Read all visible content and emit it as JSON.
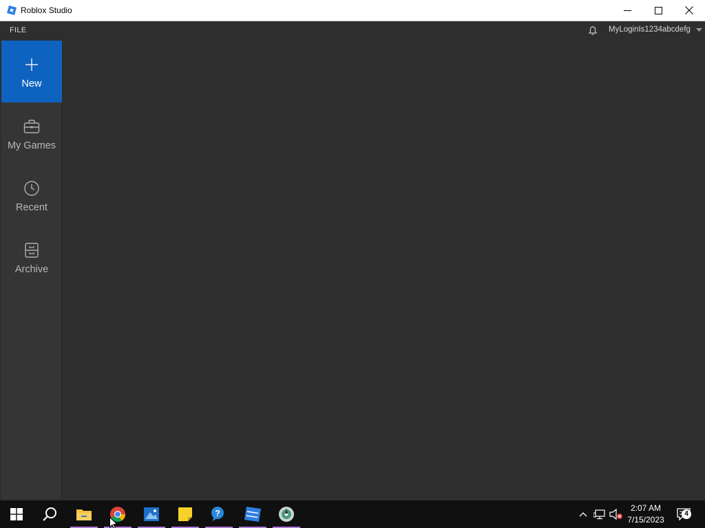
{
  "window": {
    "title": "Roblox Studio"
  },
  "menubar": {
    "file_label": "FILE",
    "username": "MyLoginIs1234abcdefg"
  },
  "sidebar": {
    "items": [
      {
        "label": "New",
        "icon": "plus-icon",
        "active": true
      },
      {
        "label": "My Games",
        "icon": "briefcase-icon",
        "active": false
      },
      {
        "label": "Recent",
        "icon": "clock-icon",
        "active": false
      },
      {
        "label": "Archive",
        "icon": "archive-icon",
        "active": false
      }
    ]
  },
  "taskbar": {
    "apps": [
      "start-icon",
      "search-icon",
      "file-explorer-icon",
      "chrome-icon",
      "photos-icon",
      "sticky-notes-icon",
      "help-icon",
      "roblox-studio-icon",
      "disc-app-icon"
    ],
    "clock_time": "2:07 AM",
    "clock_date": "7/15/2023",
    "notification_count": "4"
  },
  "colors": {
    "accent": "#0f63c0",
    "background": "#2e2e2e",
    "sidebar": "#353535"
  }
}
